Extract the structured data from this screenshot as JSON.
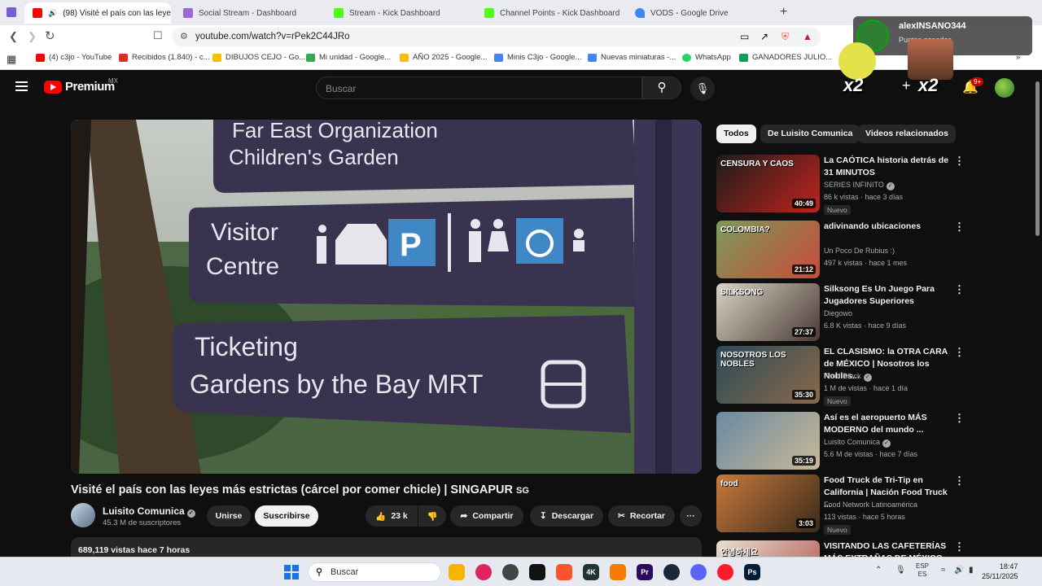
{
  "tabs": [
    {
      "label": "(98) Visité el país con las leye",
      "color": "#ff0000",
      "active": true
    },
    {
      "label": "Social Stream - Dashboard",
      "color": "#9c6ad8"
    },
    {
      "label": "Stream - Kick Dashboard",
      "color": "#53fc18"
    },
    {
      "label": "Channel Points - Kick Dashboard",
      "color": "#53fc18"
    },
    {
      "label": "VODS - Google Drive",
      "color": "#4285f4"
    }
  ],
  "tab_close": "✕",
  "new_tab": "+",
  "address": {
    "url": "youtube.com/watch?v=rPek2C44JRo"
  },
  "bookmarks": [
    {
      "label": "(4) c3jo - YouTube",
      "color": "#ff0000"
    },
    {
      "label": "Recibidos (1.840) - c...",
      "color": "#d93025"
    },
    {
      "label": "DIBUJOS CEJO - Go...",
      "color": "#fbbc04"
    },
    {
      "label": "Mi unidad - Google...",
      "color": "#34a853"
    },
    {
      "label": "AÑO 2025 - Google...",
      "color": "#fbbc04"
    },
    {
      "label": "Minis C3jo - Google...",
      "color": "#4285f4"
    },
    {
      "label": "Nuevas miniaturas -...",
      "color": "#4285f4"
    },
    {
      "label": "WhatsApp",
      "color": "#25d366"
    },
    {
      "label": "GANADORES JULIO...",
      "color": "#0f9d58"
    }
  ],
  "youtube": {
    "logo": "Premium",
    "country": "MX",
    "search_placeholder": "Buscar",
    "notif_count": "9+"
  },
  "video": {
    "title": "Visité el país con las leyes más estrictas (cárcel por comer chicle) | SINGAPUR",
    "title_flag": "SG",
    "channel": "Luisito Comunica",
    "subscribers": "45.3 M de suscriptores",
    "join": "Unirse",
    "subscribe": "Suscribirse",
    "likes": "23 k",
    "share": "Compartir",
    "download": "Descargar",
    "clip": "Recortar",
    "more": "···",
    "views_line": "689,119 vistas  hace 7 horas",
    "sign_lines": [
      "Far East Organization",
      "Children's Garden",
      "Visitor",
      "Centre",
      "Ticketing",
      "Gardens by the Bay MRT"
    ],
    "sign_p": "P"
  },
  "chips": [
    "Todos",
    "De Luisito Comunica",
    "Videos relacionados"
  ],
  "related": [
    {
      "title": "La CAÓTICA historia detrás de 31 MINUTOS",
      "channel": "SERIES INFINITO",
      "verified": true,
      "meta": "86 k vistas · hace 3 días",
      "duration": "40:49",
      "badge": "Nuevo",
      "thumb_text": "CENSURA Y CAOS",
      "c1": "#1c1c1c",
      "c2": "#c0231d"
    },
    {
      "title": "adivinando ubicaciones",
      "channel": "Un Poco De Rubius :)",
      "verified": false,
      "meta": "497 k vistas · hace 1 mes",
      "duration": "21:12",
      "badge": "",
      "thumb_text": "COLOMBIA?",
      "c1": "#7a9b5a",
      "c2": "#c94a3a"
    },
    {
      "title": "Silksong Es Un Juego Para Jugadores Superiores",
      "channel": "Diegowo",
      "verified": false,
      "meta": "6.8 K vistas · hace 9 días",
      "duration": "27:37",
      "badge": "",
      "thumb_text": "SILKSONG",
      "c1": "#d9d2c4",
      "c2": "#4a3b35"
    },
    {
      "title": "EL CLASISMO: la OTRA CARA de MÉXICO | Nosotros los Nobles...",
      "channel": "Farid Dieck",
      "verified": true,
      "meta": "1 M de vistas · hace 1 día",
      "duration": "35:30",
      "badge": "Nuevo",
      "thumb_text": "NOSOTROS LOS NOBLES",
      "c1": "#2a4a5a",
      "c2": "#8a6a4a"
    },
    {
      "title": "Así es el aeropuerto MÁS MODERNO del mundo ...",
      "channel": "Luisito Comunica",
      "verified": true,
      "meta": "5.6 M de vistas · hace 7 días",
      "duration": "35:19",
      "badge": "",
      "thumb_text": "",
      "c1": "#6a8aa0",
      "c2": "#c8b898"
    },
    {
      "title": "Food Truck de Tri-Tip en California | Nación Food Truck ...",
      "channel": "Food Network Latinoamérica",
      "verified": false,
      "meta": "113 vistas · hace 5 horas",
      "duration": "3:03",
      "badge": "Nuevo",
      "thumb_text": "food",
      "c1": "#c87a3a",
      "c2": "#3a2a1a"
    },
    {
      "title": "VISITANDO LAS CAFETERÍAS MÁS EXTRAÑAS DE MÉXICO",
      "channel": "",
      "verified": false,
      "meta": "",
      "duration": "",
      "badge": "",
      "thumb_text": "안녕하세요",
      "c1": "#e8e0d0",
      "c2": "#b05050"
    }
  ],
  "overlay": {
    "user": "alexINSANO344",
    "sub": "Puntos ganados",
    "mult_left": "x2",
    "mult_right": "x2"
  },
  "taskbar": {
    "search": "Buscar",
    "lang_top": "ESP",
    "lang_bottom": "ES",
    "time": "18:47",
    "date": "25/11/2025"
  }
}
